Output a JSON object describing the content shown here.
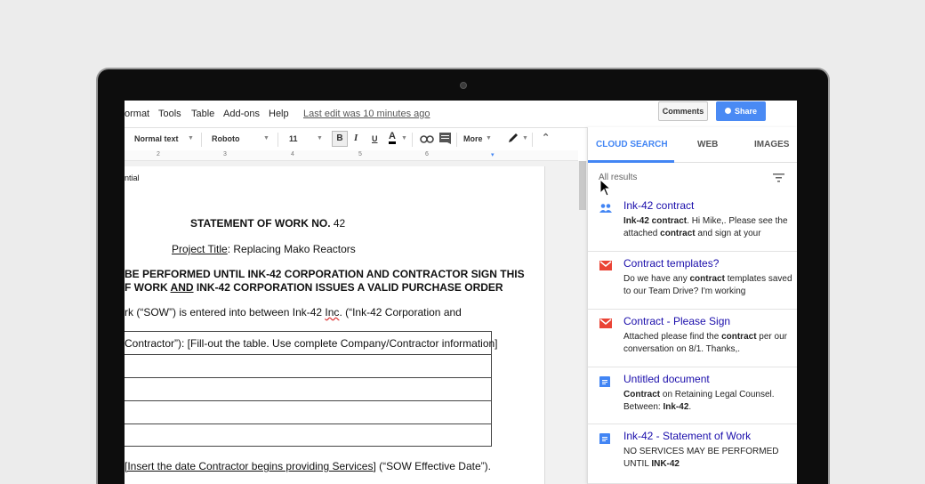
{
  "menubar": {
    "items": [
      "ormat",
      "Tools",
      "Table",
      "Add-ons",
      "Help"
    ],
    "last_edit": "Last edit was 10 minutes ago",
    "comments_label": "Comments",
    "share_label": "Share"
  },
  "toolbar": {
    "style": "Normal text",
    "font": "Roboto",
    "size": "11",
    "bold": "B",
    "italic": "I",
    "underline": "U",
    "text_color": "A",
    "more": "More"
  },
  "ruler": [
    "2",
    "3",
    "4",
    "5",
    "6"
  ],
  "document": {
    "header_note": "ntial",
    "title_prefix": "STATEMENT OF WORK NO.",
    "title_number": " 42",
    "project_label": "Project Title",
    "project_value": ": Replacing Mako Reactors",
    "warning_line1": "BE PERFORMED UNTIL INK-42 CORPORATION AND CONTRACTOR SIGN THIS",
    "warning_line2_a": "F WORK ",
    "warning_line2_and": "AND",
    "warning_line2_b": " INK-42 CORPORATION ISSUES A VALID PURCHASE ORDER",
    "intro_a": "rk (“SOW”) is entered into between Ink-42 ",
    "intro_inc": "Inc",
    "intro_b": ". (“Ink-42 Corporation and",
    "table_header": "Contractor”): [Fill-out the table.  Use complete Company/Contractor information]",
    "effective_a": "[Insert the date Contractor begins providing Services]",
    "effective_b": " (“SOW Effective Date”)."
  },
  "panel": {
    "tabs": [
      "CLOUD SEARCH",
      "WEB",
      "IMAGES"
    ],
    "all_results": "All results",
    "results": [
      {
        "icon": "people-icon",
        "title": "Ink-42 contract",
        "snippet": [
          "Ink-42 contract",
          ". Hi Mike,. Please see the attached ",
          "contract",
          " and sign at your"
        ]
      },
      {
        "icon": "gmail-icon",
        "title": "Contract templates?",
        "snippet": [
          "",
          "Do we have any ",
          "contract",
          " templates saved to our Team Drive? I'm working"
        ]
      },
      {
        "icon": "gmail-icon",
        "title": "Contract - Please Sign",
        "snippet": [
          "",
          "Attached please find the ",
          "contract",
          " per our conversation on 8/1. Thanks,."
        ]
      },
      {
        "icon": "docs-icon",
        "title": "Untitled document",
        "snippet": [
          "Contract",
          " on Retaining Legal Counsel. Between: ",
          "Ink-42",
          "."
        ]
      },
      {
        "icon": "docs-icon",
        "title": "Ink-42 - Statement of Work",
        "snippet": [
          "",
          "NO SERVICES MAY BE PERFORMED UNTIL ",
          "INK-42",
          ""
        ]
      }
    ]
  },
  "colors": {
    "accent": "#4285f4",
    "link": "#1a0dab",
    "gmail": "#ea4335",
    "docs": "#4285f4"
  }
}
